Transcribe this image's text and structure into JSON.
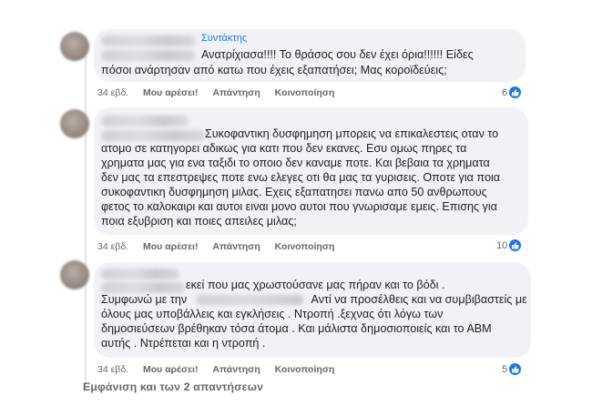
{
  "comments": [
    {
      "role": "Συντάκτης",
      "lines": [
        "Ανατρίχιασα!!!! Το θράσος σου δεν έχει όρια!!!!!! Είδες",
        "πόσοι ανάρτησαν από κατω που έχεις εξαπατήσει; Μας κοροϊδεύεις;"
      ],
      "time": "34 εβδ.",
      "like": "Μου αρέσει!",
      "reply": "Απάντηση",
      "share": "Κοινοποίηση",
      "reactions": "6"
    },
    {
      "lines": [
        "Συκοφαντικη δυσφημηση μπορεις να επικαλεστεις οταν το",
        "ατομο σε κατηγορει αδικως για κατι που δεν εκανες. Εσυ ομως πηρες τα",
        "χρηματα μας για ενα ταξιδι το οποιο δεν καναμε ποτε. Και βεβαια τα χρηματα",
        "δεν μας τα επεστρεψες ποτε ενω ελεγες οτι θα μας τα γυρισεις. Οποτε για ποια",
        "συκοφαντικη δυσφημηση μιλας. Εχεις εξαπατησει πανω απο 50 ανθρωπους",
        "φετος το καλοκαιρι και αυτοι ειναι μονο αυτοι που γνωρισαμε εμεις. Επισης για",
        "ποια εξυβριση και ποιες απειλες μιλας;"
      ],
      "time": "34 εβδ.",
      "like": "Μου αρέσει!",
      "reply": "Απάντηση",
      "share": "Κοινοποίηση",
      "reactions": "10"
    },
    {
      "line1_after": "εκεί που μας χρωστούσανε μας πήραν και το βόδι .",
      "line2_before": "Συμφωνώ με την",
      "line2_after": "Αντί να προσέλθεις και να συμβιβαστείς με",
      "lines": [
        "όλους μας υποβάλλεις και εγκλήσεις . Ντροπή .ξεχνας ότι λόγω των",
        "δημοσιεύσεων βρέθηκαν τόσα άτομα . Και μάλιστα δημοσιοποιείς και το ΑΒΜ",
        "αυτής . Ντρέπεται και η ντροπή ."
      ],
      "time": "34 εβδ.",
      "like": "Μου αρέσει!",
      "reply": "Απάντηση",
      "share": "Κοινοποίηση",
      "reactions": "5"
    }
  ],
  "show_replies": "Εμφάνιση και των 2 απαντήσεων",
  "colors": {
    "link_blue": "#1877f2",
    "bubble": "#f0f2f5",
    "muted": "#65676b"
  },
  "icons": [
    "like-reaction-icon"
  ]
}
